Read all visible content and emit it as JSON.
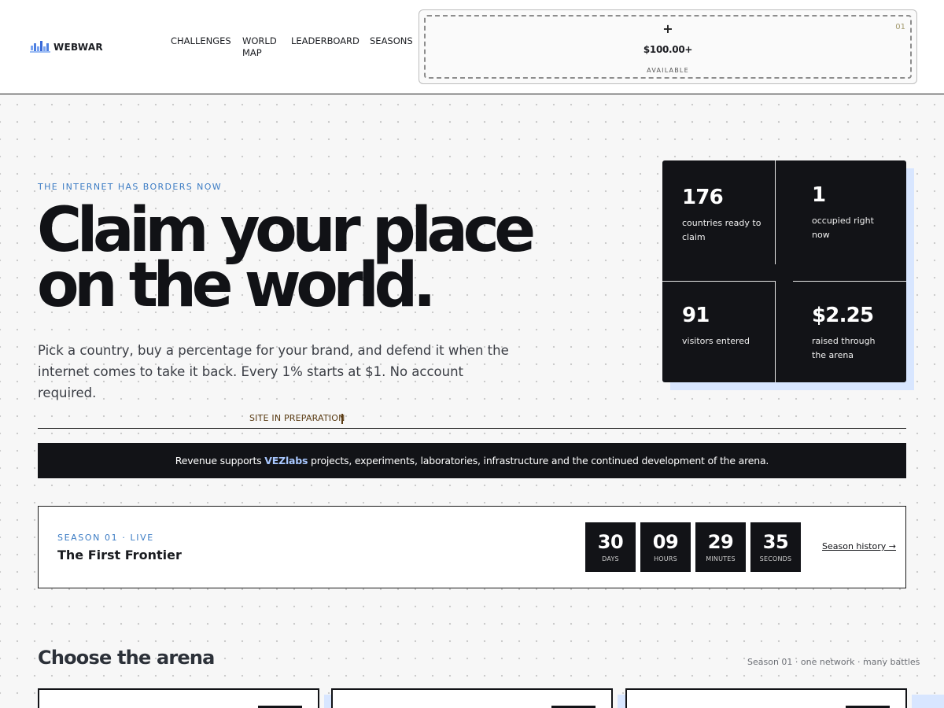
{
  "header": {
    "logo_text": "WEBWAR",
    "nav": [
      {
        "label": "CHALLENGES"
      },
      {
        "label": "WORLD MAP"
      },
      {
        "label": "LEADERBOARD"
      },
      {
        "label": "SEASONS"
      }
    ],
    "slot": {
      "plus": "+",
      "price": "$100.00+",
      "status": "AVAILABLE",
      "number": "01"
    }
  },
  "hero": {
    "eyebrow": "THE INTERNET HAS BORDERS NOW",
    "title_line1": "Claim your place",
    "title_line2": "on the world.",
    "subtitle": "Pick a country, buy a percentage for your brand, and defend it when the internet comes to take it back. Every 1% starts at $1. No account required."
  },
  "stats": [
    {
      "value": "176",
      "label": "countries ready to claim"
    },
    {
      "value": "1",
      "label": "occupied right now"
    },
    {
      "value": "91",
      "label": "visitors entered"
    },
    {
      "value": "$2.25",
      "label": "raised through the arena"
    }
  ],
  "preparation": {
    "label": "SITE IN PREPARATION"
  },
  "banner": {
    "prefix": "Revenue supports ",
    "accent": "VEZlabs",
    "suffix": " projects, experiments, laboratories, infrastructure and the continued development of the arena."
  },
  "season": {
    "eyebrow": "SEASON 01 · LIVE",
    "title": "The First Frontier",
    "countdown": [
      {
        "value": "30",
        "unit": "DAYS"
      },
      {
        "value": "09",
        "unit": "HOURS"
      },
      {
        "value": "29",
        "unit": "MINUTES"
      },
      {
        "value": "35",
        "unit": "SECONDS"
      }
    ],
    "history_link": "Season history →"
  },
  "arena": {
    "title": "Choose the arena",
    "meta": "Season 01 · one network · many battles"
  },
  "colors": {
    "accent_blue": "#3c7cc4",
    "dark": "#121317",
    "shadow_blue": "#d8e6ff",
    "banner_accent": "#a9c8ff"
  },
  "icons": [
    "webwar-logo-icon"
  ]
}
